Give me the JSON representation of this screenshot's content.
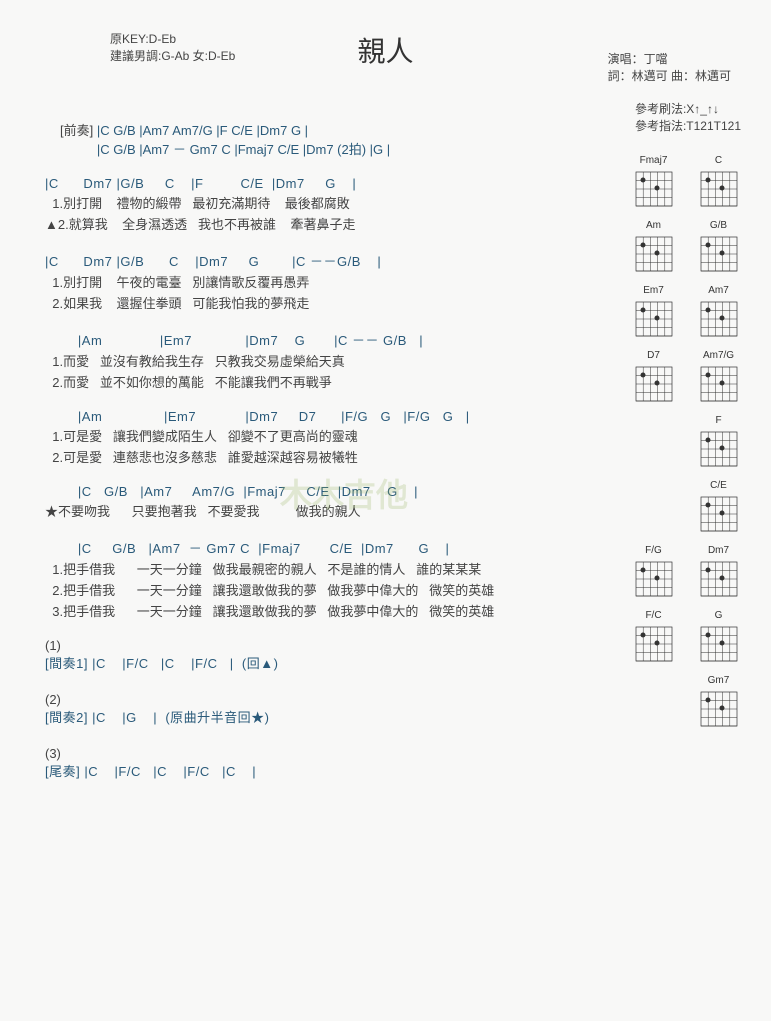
{
  "title": "親人",
  "meta": {
    "original_key": "原KEY:D-Eb",
    "suggested": "建議男調:G-Ab 女:D-Eb",
    "singer": "演唱：丁噹",
    "credits": "詞：林邁可  曲：林邁可"
  },
  "reference": {
    "strum": "參考刷法:X↑_↑↓",
    "finger": "參考指法:T121T121"
  },
  "intro": {
    "label": "[前奏]",
    "line1": "|C   G/B   |Am7    Am7/G   |F     C/E   |Dm7   G   |",
    "line2": "|C   G/B   |Am7 － Gm7  C  |Fmaj7   C/E   |Dm7 (2拍)  |G    |"
  },
  "verse1": {
    "chords": "|C      Dm7 |G/B     C    |F         C/E  |Dm7     G    |",
    "l1": "  1.別打開    禮物的緞帶   最初充滿期待    最後都腐敗",
    "l2": "▲2.就算我    全身濕透透   我也不再被誰    牽著鼻子走"
  },
  "verse2": {
    "chords": "|C      Dm7 |G/B      C    |Dm7     G        |C －－G/B    |",
    "l1": "  1.別打開    午夜的電臺   別讓情歌反覆再愚弄",
    "l2": "  2.如果我    還握住拳頭   可能我怕我的夢飛走"
  },
  "pre1": {
    "chords": "        |Am              |Em7             |Dm7    G       |C －－ G/B   |",
    "l1": "  1.而愛   並沒有教給我生存   只教我交易虛榮給天真",
    "l2": "  2.而愛   並不如你想的萬能   不能讓我們不再戰爭"
  },
  "pre2": {
    "chords": "        |Am               |Em7            |Dm7     D7      |F/G   G   |F/G   G   |",
    "l1": "  1.可是愛   讓我們變成陌生人   卻變不了更高尚的靈魂",
    "l2": "  2.可是愛   連慈悲也沒多慈悲   誰愛越深越容易被犧牲"
  },
  "chorus1": {
    "chords": "        |C   G/B   |Am7     Am7/G  |Fmaj7     C/E  |Dm7    G    |",
    "l1": "★不要吻我      只要抱著我   不要愛我          做我的親人"
  },
  "chorus2": {
    "chords": "        |C     G/B   |Am7  － Gm7 C  |Fmaj7       C/E  |Dm7      G    |",
    "l1": "  1.把手借我      一天一分鐘   做我最親密的親人   不是誰的情人   誰的某某某",
    "l2": "  2.把手借我      一天一分鐘   讓我還敢做我的夢   做我夢中偉大的   微笑的英雄",
    "l3": "  3.把手借我      一天一分鐘   讓我還敢做我的夢   做我夢中偉大的   微笑的英雄"
  },
  "coda": {
    "n1": "(1)",
    "int1": "[間奏1] |C    |F/C   |C    |F/C   |  (回▲)",
    "n2": "(2)",
    "int2": "[間奏2] |C    |G    |  (原曲升半音回★)",
    "n3": "(3)",
    "outro": "[尾奏] |C    |F/C   |C    |F/C   |C    |"
  },
  "chord_diagrams": [
    [
      "Fmaj7",
      "C"
    ],
    [
      "Am",
      "G/B"
    ],
    [
      "Em7",
      "Am7"
    ],
    [
      "D7",
      "Am7/G"
    ],
    [
      "",
      "F"
    ],
    [
      "",
      "C/E"
    ],
    [
      "F/G",
      "Dm7"
    ],
    [
      "F/C",
      "G"
    ],
    [
      "",
      "Gm7"
    ]
  ],
  "watermark": "木木吉他"
}
